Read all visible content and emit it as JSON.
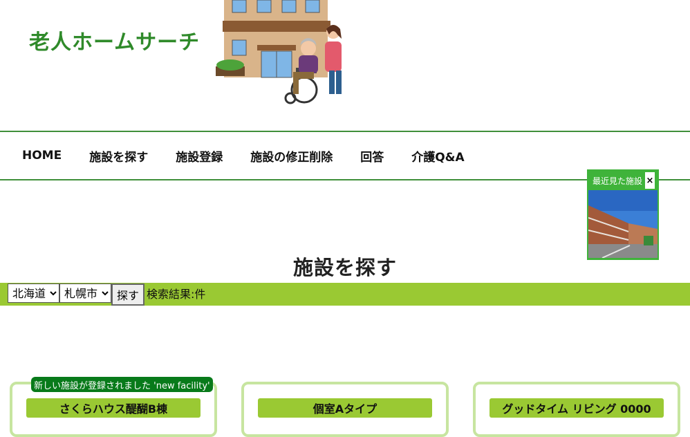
{
  "site": {
    "title": "老人ホームサーチ"
  },
  "nav": {
    "items": [
      {
        "label": "HOME"
      },
      {
        "label": "施設を探す"
      },
      {
        "label": "施設登録"
      },
      {
        "label": "施設の修正削除"
      },
      {
        "label": "回答"
      },
      {
        "label": "介護Q&A"
      }
    ]
  },
  "recent": {
    "title": "最近見た施設",
    "close": "×"
  },
  "main": {
    "heading": "施設を探す"
  },
  "search": {
    "prefecture": "北海道",
    "city": "札幌市",
    "button": "探す",
    "result_label": "検索結果:件"
  },
  "notice": {
    "text": "新しい施設が登録されました 'new facility'"
  },
  "cards": [
    {
      "title": "さくらハウス醍醐B棟"
    },
    {
      "title": "個室Aタイプ"
    },
    {
      "title": "グッドタイム リビング 0000"
    }
  ],
  "colors": {
    "accent_green": "#9ac933",
    "dark_green": "#2f8a2a",
    "card_border": "#c7e5a0",
    "badge_green": "#087a1a"
  }
}
